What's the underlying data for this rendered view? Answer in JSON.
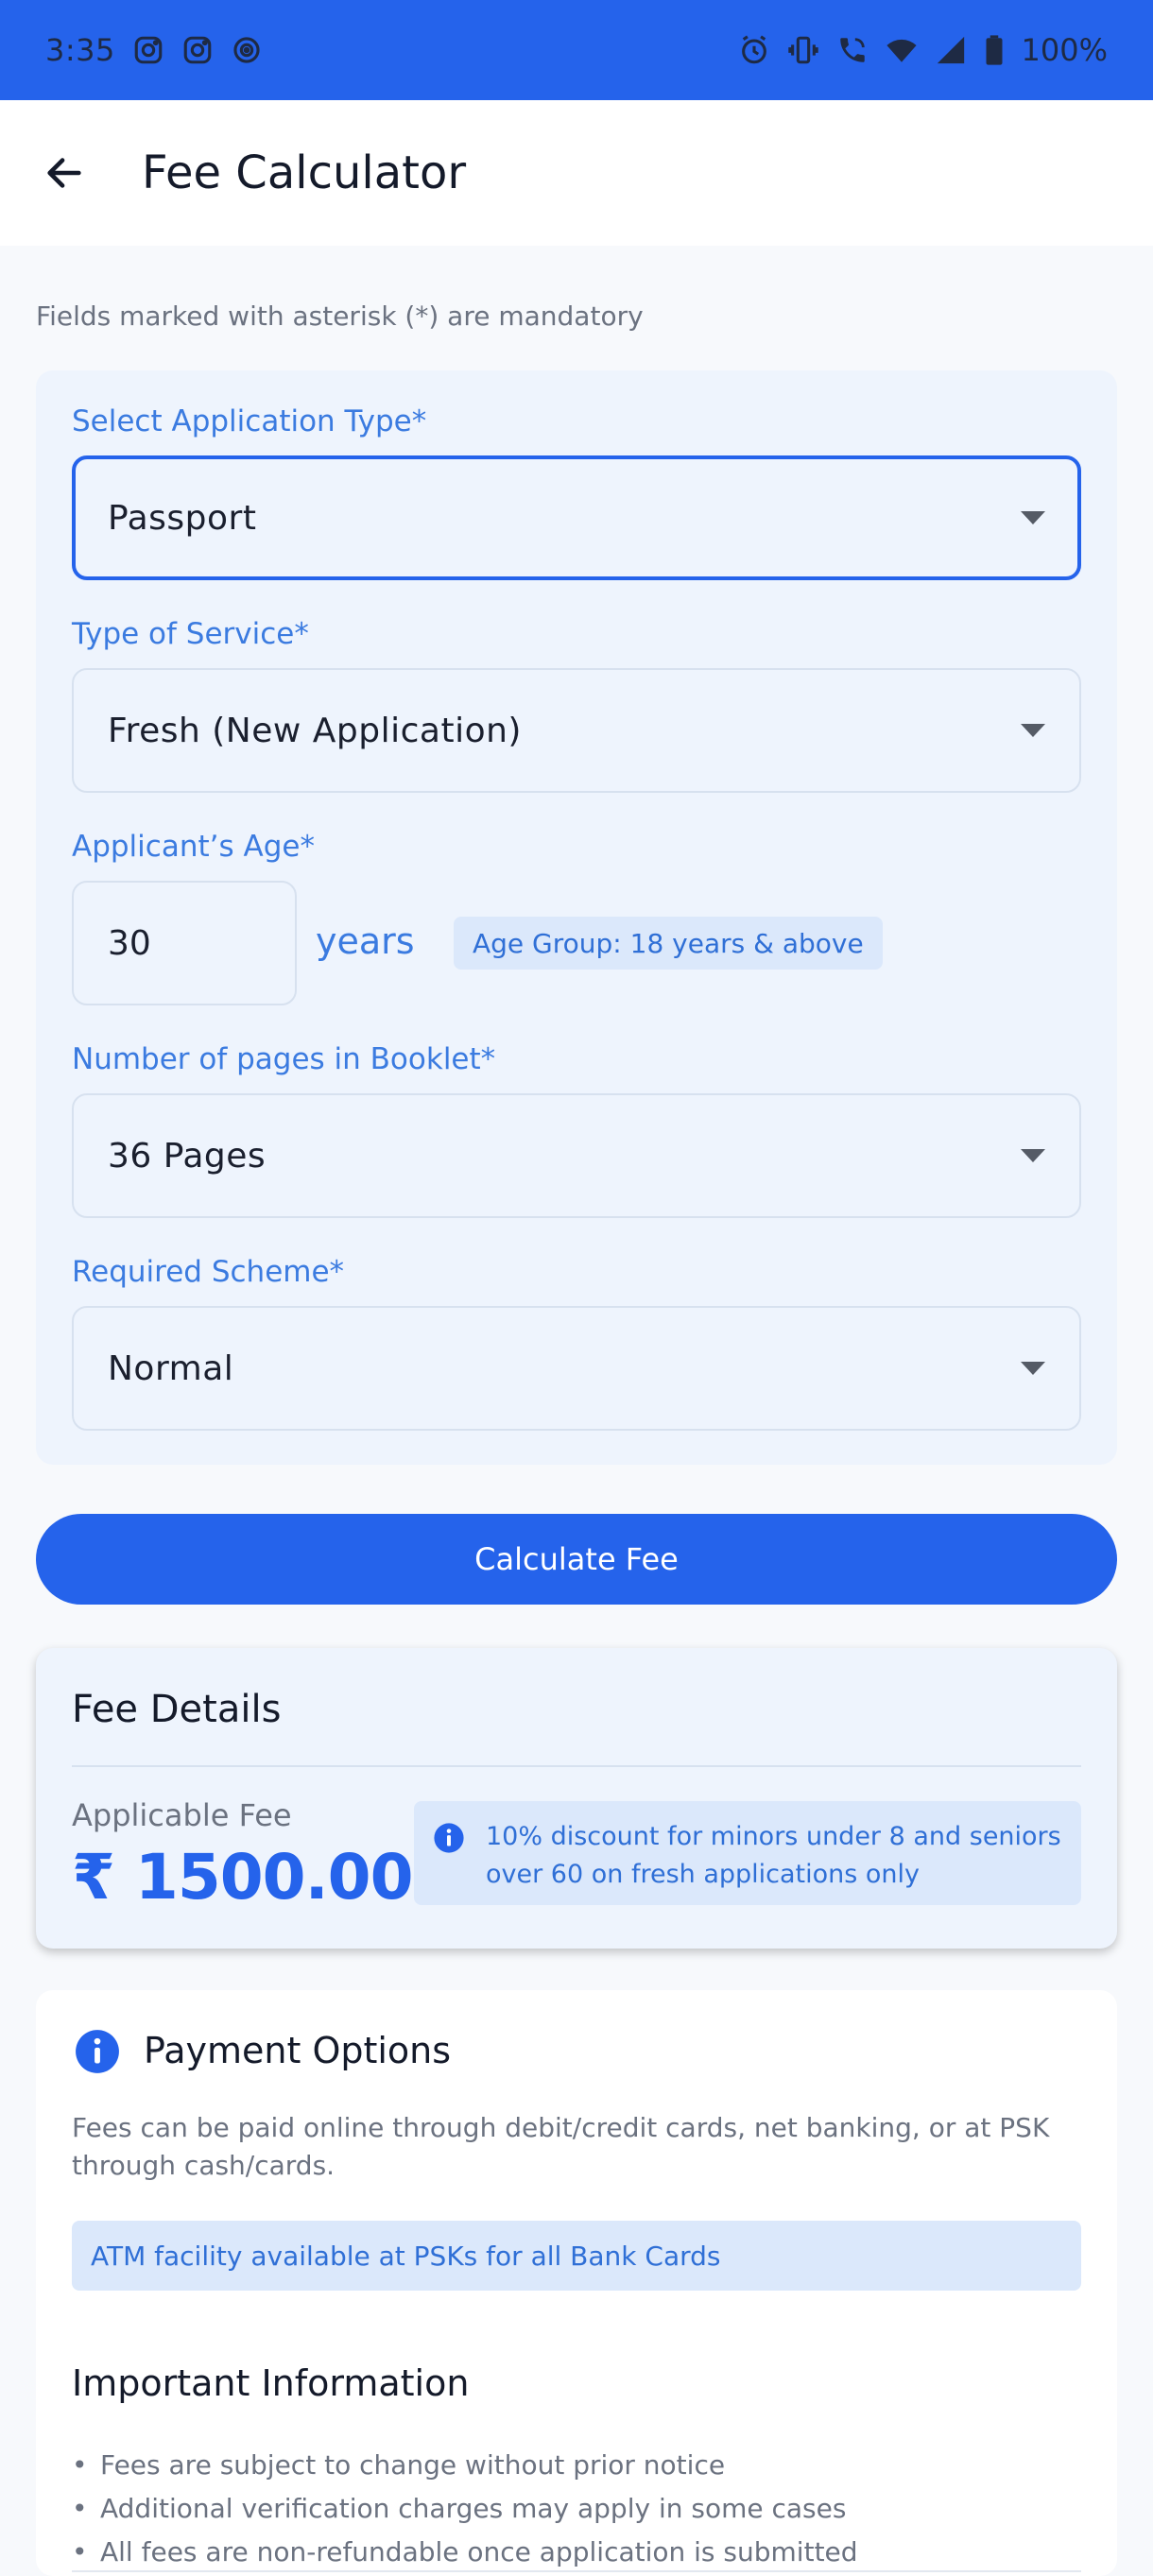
{
  "status_bar": {
    "time": "3:35",
    "battery": "100%",
    "left_icons": [
      "instagram-icon",
      "instagram-icon",
      "vpn-icon"
    ],
    "right_icons": [
      "alarm-icon",
      "vibrate-icon",
      "wifi-call-icon",
      "wifi-icon",
      "signal-icon",
      "battery-icon"
    ]
  },
  "app_bar": {
    "title": "Fee Calculator",
    "back_icon": "arrow-left-icon"
  },
  "form": {
    "mandatory_note": "Fields marked with asterisk (*) are mandatory",
    "application_type": {
      "label": "Select Application Type*",
      "value": "Passport"
    },
    "service_type": {
      "label": "Type of Service*",
      "value": "Fresh (New Application)"
    },
    "age": {
      "label": "Applicant’s Age*",
      "value": "30",
      "unit": "years",
      "badge": "Age Group: 18 years & above"
    },
    "pages": {
      "label": "Number of pages in Booklet*",
      "value": "36 Pages"
    },
    "scheme": {
      "label": "Required Scheme*",
      "value": "Normal"
    }
  },
  "calculate_button": "Calculate Fee",
  "fee_details": {
    "title": "Fee Details",
    "label": "Applicable Fee",
    "amount": "₹ 1500.00",
    "note": "10% discount for minors under 8 and seniors over 60 on fresh applications only"
  },
  "payment": {
    "title": "Payment Options",
    "description": "Fees can be paid online through debit/credit cards, net banking, or at PSK through cash/cards.",
    "atm_note": "ATM facility available at PSKs for all Bank Cards"
  },
  "important": {
    "title": "Important Information",
    "items": [
      "Fees are subject to change without prior notice",
      "Additional verification charges may apply in some cases",
      "All fees are non-refundable once application is submitted"
    ]
  },
  "colors": {
    "primary": "#2563eb",
    "label_blue": "#3b7be0",
    "card_bg": "#eef4fd",
    "badge_bg": "#dbe8fb"
  }
}
